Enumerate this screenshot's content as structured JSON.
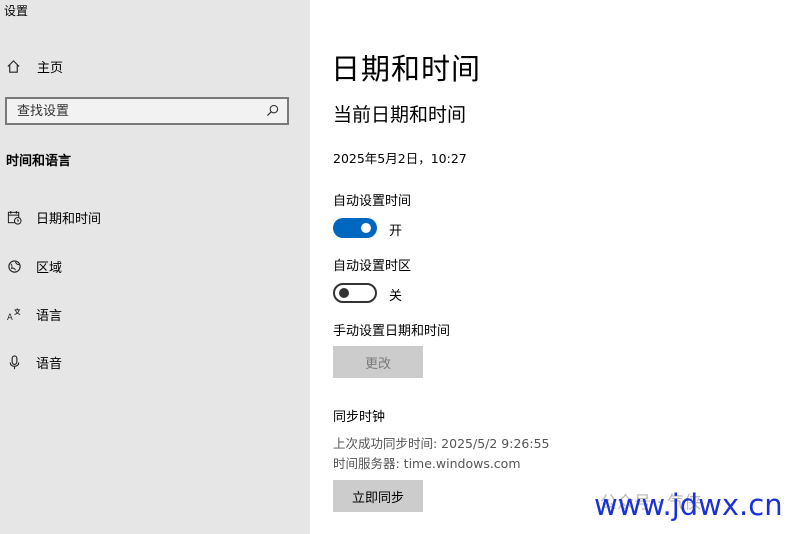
{
  "app": {
    "title": "设置"
  },
  "sidebar": {
    "home_label": "主页",
    "search_placeholder": "查找设置",
    "section_heading": "时间和语言",
    "items": [
      {
        "label": "日期和时间",
        "icon": "calendar-clock-icon"
      },
      {
        "label": "区域",
        "icon": "globe-icon"
      },
      {
        "label": "语言",
        "icon": "language-icon"
      },
      {
        "label": "语音",
        "icon": "microphone-icon"
      }
    ]
  },
  "main": {
    "page_title": "日期和时间",
    "subtitle": "当前日期和时间",
    "current_datetime": "2025年5月2日，10:27",
    "auto_time": {
      "label": "自动设置时间",
      "state_label": "开",
      "on": true
    },
    "auto_timezone": {
      "label": "自动设置时区",
      "state_label": "关",
      "on": false
    },
    "manual": {
      "label": "手动设置日期和时间",
      "button_label": "更改"
    },
    "sync": {
      "heading": "同步时钟",
      "last_sync": "上次成功同步时间: 2025/5/2 9:26:55",
      "time_server": "时间服务器: time.windows.com",
      "button_label": "立即同步"
    }
  },
  "watermark": {
    "text": "www.jdwx.cn",
    "faint_text": "公众号 · 气侠"
  },
  "colors": {
    "accent": "#0067c0",
    "sidebar_bg": "#e6e6e6",
    "watermark": "#1a30d8"
  }
}
